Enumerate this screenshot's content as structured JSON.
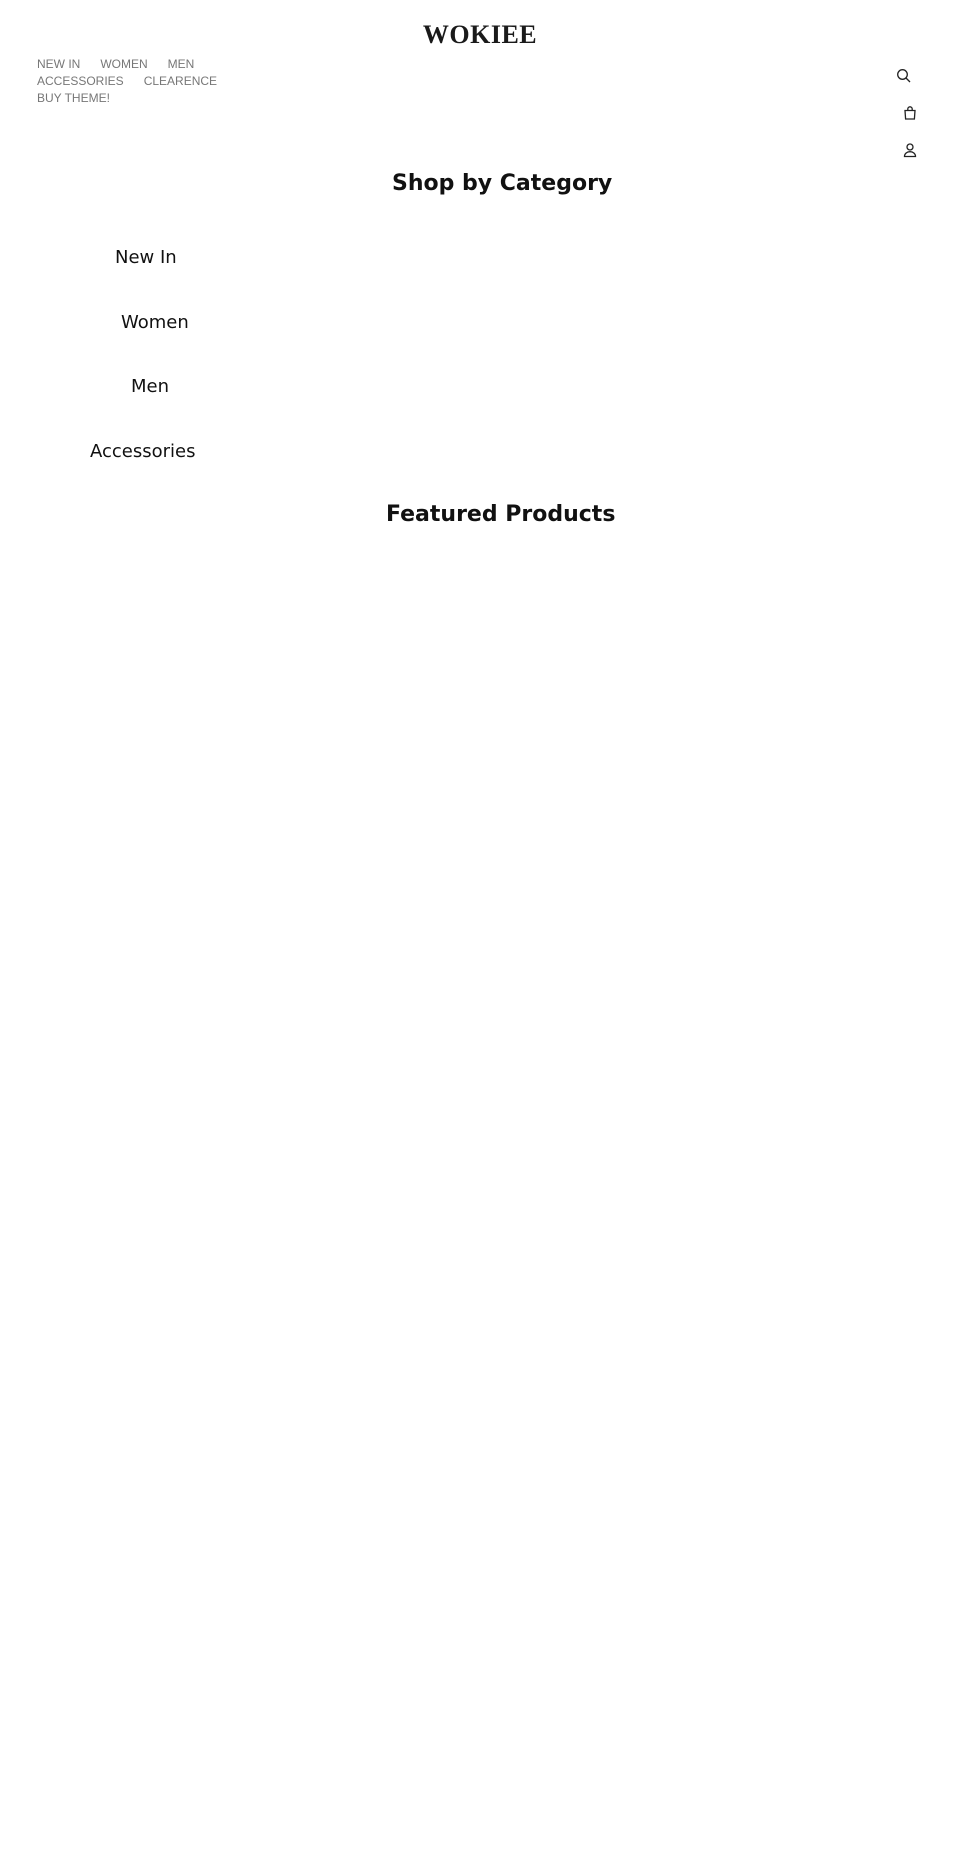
{
  "brand": {
    "logo_text": "WOKIEE"
  },
  "nav": {
    "rows": [
      [
        "NEW IN",
        "WOMEN",
        "MEN"
      ],
      [
        "ACCESSORIES",
        "CLEARENCE"
      ],
      [
        "BUY THEME!"
      ]
    ]
  },
  "header_icons": [
    "search-icon",
    "cart-icon",
    "account-icon"
  ],
  "sections": {
    "shop_by_category": {
      "title": "Shop by Category",
      "items": [
        "New In",
        "Women",
        "Men",
        "Accessories"
      ]
    },
    "featured_products": {
      "title": "Featured Products"
    }
  },
  "colors": {
    "nav_text": "#777777",
    "heading_text": "#111111",
    "background": "#ffffff"
  }
}
